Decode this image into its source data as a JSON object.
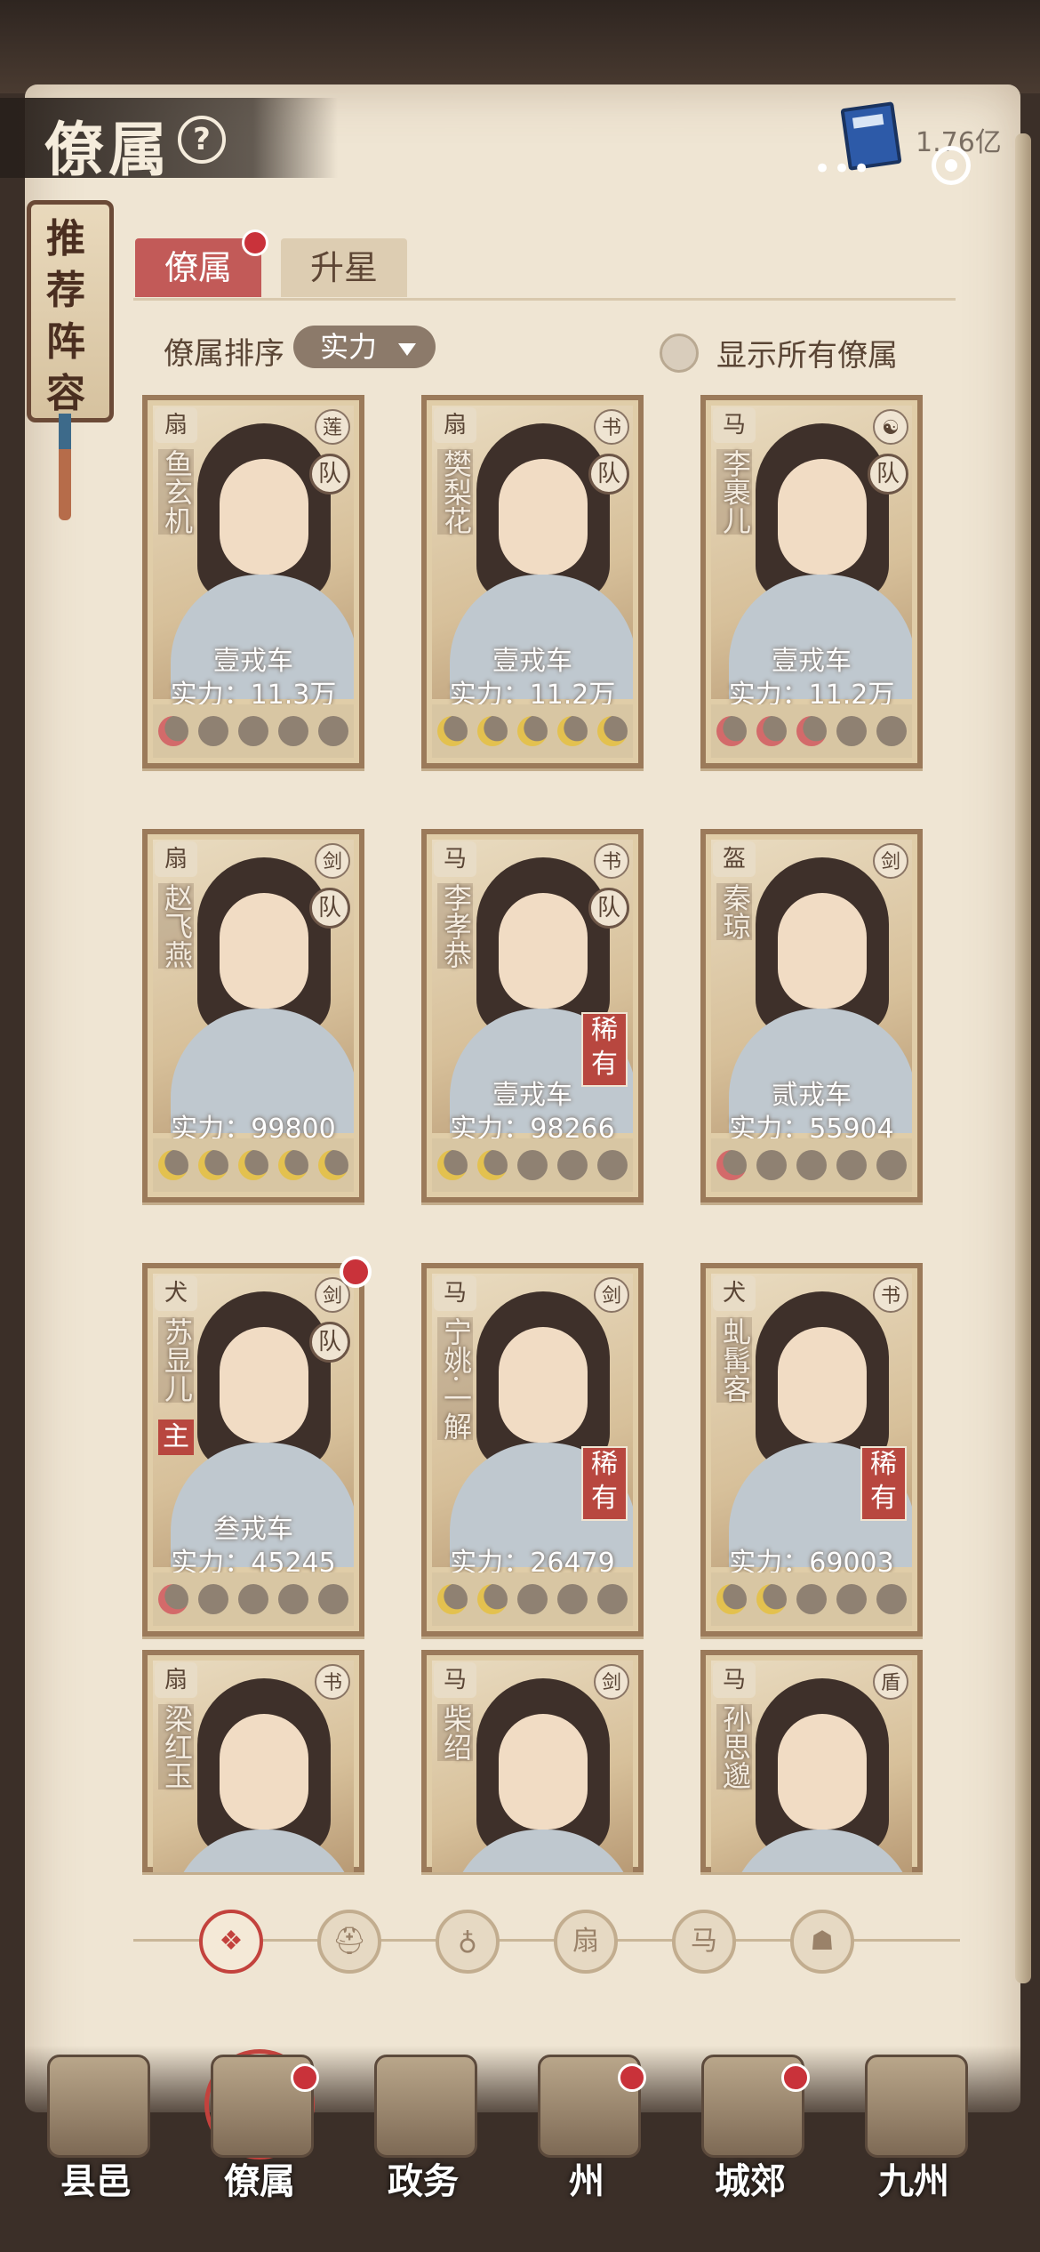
{
  "header": {
    "title": "僚属",
    "help_icon": "?",
    "currency": "1.76亿",
    "more_dots": "•••"
  },
  "side_plaque": {
    "text": "推荐阵容"
  },
  "tabs": [
    {
      "label": "僚属",
      "active": true
    },
    {
      "label": "升星",
      "active": false
    }
  ],
  "sort": {
    "label": "僚属排序",
    "value": "实力"
  },
  "show_all": {
    "label": "显示所有僚属",
    "checked": false
  },
  "cards": [
    {
      "name": "鱼玄机",
      "type": "扇",
      "badge": "莲",
      "team": "队",
      "rank": "壹戎车",
      "power": "实力：11.3万",
      "moons": [
        "red",
        "empty",
        "empty",
        "empty",
        "empty"
      ]
    },
    {
      "name": "樊梨花",
      "type": "扇",
      "badge": "书",
      "team": "队",
      "rank": "壹戎车",
      "power": "实力：11.2万",
      "moons": [
        "gold",
        "gold",
        "gold",
        "gold",
        "gold"
      ]
    },
    {
      "name": "李裹儿",
      "type": "马",
      "badge": "☯",
      "team": "队",
      "rank": "壹戎车",
      "power": "实力：11.2万",
      "moons": [
        "red",
        "red",
        "red",
        "empty",
        "empty"
      ]
    },
    {
      "name": "赵飞燕",
      "type": "扇",
      "badge": "剑",
      "team": "队",
      "rank": "",
      "power": "实力：99800",
      "moons": [
        "gold",
        "gold",
        "gold",
        "gold",
        "gold"
      ]
    },
    {
      "name": "李孝恭",
      "type": "马",
      "badge": "书",
      "team": "队",
      "rank": "壹戎车",
      "power": "实力：98266",
      "rare": "稀有",
      "moons": [
        "gold",
        "gold",
        "empty",
        "empty",
        "empty"
      ]
    },
    {
      "name": "秦琼",
      "type": "盔",
      "badge": "剑",
      "rank": "贰戎车",
      "power": "实力：55904",
      "moons": [
        "red",
        "empty",
        "empty",
        "empty",
        "empty"
      ]
    },
    {
      "name": "苏显儿",
      "type": "犬",
      "badge": "剑",
      "team": "队",
      "lord": "主",
      "rank": "叁戎车",
      "power": "实力：45245",
      "moons": [
        "red",
        "empty",
        "empty",
        "empty",
        "empty"
      ],
      "dot": true
    },
    {
      "name": "宁姚·一解",
      "type": "马",
      "badge": "剑",
      "rank": "",
      "power": "实力：26479",
      "rare": "稀有",
      "moons": [
        "gold",
        "gold",
        "empty",
        "empty",
        "empty"
      ]
    },
    {
      "name": "虬髯客",
      "type": "犬",
      "badge": "书",
      "rank": "",
      "power": "实力：69003",
      "rare": "稀有",
      "moons": [
        "gold",
        "gold",
        "empty",
        "empty",
        "empty"
      ]
    },
    {
      "name": "梁红玉",
      "type": "扇",
      "badge": "书"
    },
    {
      "name": "柴绍",
      "type": "马",
      "badge": "剑"
    },
    {
      "name": "孙思邈",
      "type": "马",
      "badge": "盾"
    }
  ],
  "filters": [
    {
      "icon": "all-icon",
      "glyph": "❖",
      "active": true
    },
    {
      "icon": "helmet-icon",
      "glyph": "⛑",
      "active": false
    },
    {
      "icon": "gourd-icon",
      "glyph": "♁",
      "active": false
    },
    {
      "icon": "fan-icon",
      "glyph": "扇",
      "active": false
    },
    {
      "icon": "horse-icon",
      "glyph": "马",
      "active": false
    },
    {
      "icon": "mask-icon",
      "glyph": "☗",
      "active": false
    }
  ],
  "nav": [
    {
      "label": "县邑",
      "dot": false,
      "active": false
    },
    {
      "label": "僚属",
      "dot": true,
      "active": true
    },
    {
      "label": "政务",
      "dot": false,
      "active": false
    },
    {
      "label": "州",
      "dot": true,
      "active": false
    },
    {
      "label": "城郊",
      "dot": true,
      "active": false
    },
    {
      "label": "九州",
      "dot": false,
      "active": false
    }
  ],
  "colors": {
    "accent": "#c25a58",
    "paper": "#efe5d3",
    "frame": "#9b7a5a"
  }
}
